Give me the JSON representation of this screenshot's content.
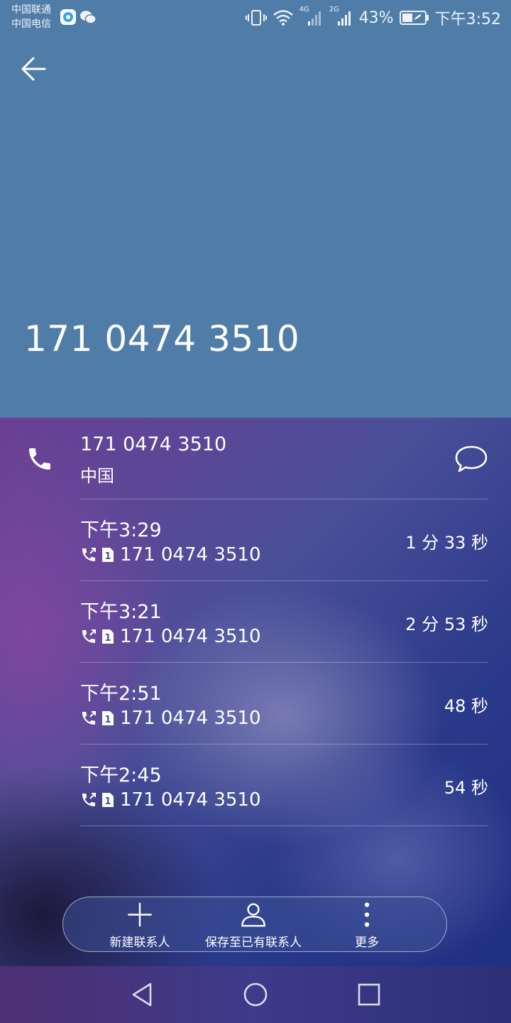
{
  "status_bar": {
    "carrier1": "中国联通",
    "carrier2": "中国电信",
    "signal1_label": "4G",
    "signal2_label": "2G",
    "battery": "43%",
    "time": "下午3:52"
  },
  "header": {
    "number": "171 0474 3510",
    "bg_color": "#507da8"
  },
  "contact": {
    "number": "171 0474 3510",
    "location": "中国"
  },
  "calls": [
    {
      "time": "下午3:29",
      "number": "171 0474 3510",
      "duration": "1 分 33 秒"
    },
    {
      "time": "下午3:21",
      "number": "171 0474 3510",
      "duration": "2 分 53 秒"
    },
    {
      "time": "下午2:51",
      "number": "171 0474 3510",
      "duration": "48 秒"
    },
    {
      "time": "下午2:45",
      "number": "171 0474 3510",
      "duration": "54 秒"
    }
  ],
  "actions": {
    "new_contact": "新建联系人",
    "save_existing": "保存至已有联系人",
    "more": "更多"
  },
  "icons": {
    "back": "arrow-left-icon",
    "phone": "phone-icon",
    "message": "message-bubble-icon",
    "call_type": "outgoing-call-icon",
    "sim": "sim-1-icon",
    "add": "plus-icon",
    "person": "person-icon",
    "more": "more-vertical-icon"
  }
}
